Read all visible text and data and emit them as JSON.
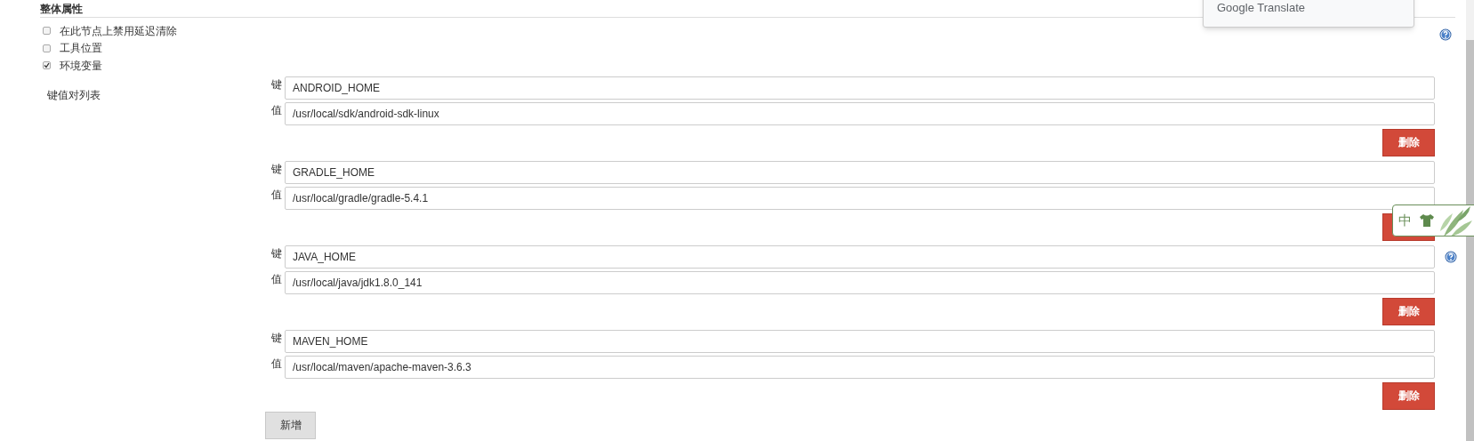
{
  "section": {
    "title": "整体属性"
  },
  "options": [
    {
      "label": "在此节点上禁用延迟清除",
      "checked": false,
      "help": true
    },
    {
      "label": "工具位置",
      "checked": false,
      "help": false
    },
    {
      "label": "环境变量",
      "checked": true,
      "help": false
    }
  ],
  "env_list": {
    "label": "键值对列表",
    "entries": [
      {
        "key_label": "键",
        "key": "ANDROID_HOME",
        "value_label": "值",
        "value": "/usr/local/sdk/android-sdk-linux",
        "delete": "删除",
        "help": false
      },
      {
        "key_label": "键",
        "key": "GRADLE_HOME",
        "value_label": "值",
        "value": "/usr/local/gradle/gradle-5.4.1",
        "help": false
      },
      {
        "key_label": "键",
        "key": "JAVA_HOME",
        "value_label": "值",
        "value": "/usr/local/java/jdk1.8.0_141",
        "delete": "删除",
        "help": true
      },
      {
        "key_label": "键",
        "key": "MAVEN_HOME",
        "value_label": "值",
        "value": "/usr/local/maven/apache-maven-3.6.3",
        "delete": "删除",
        "help": false
      }
    ],
    "add_button": "新增"
  },
  "translate_popup": {
    "label": "Google Translate"
  },
  "floating_widget": {
    "label": "中"
  }
}
